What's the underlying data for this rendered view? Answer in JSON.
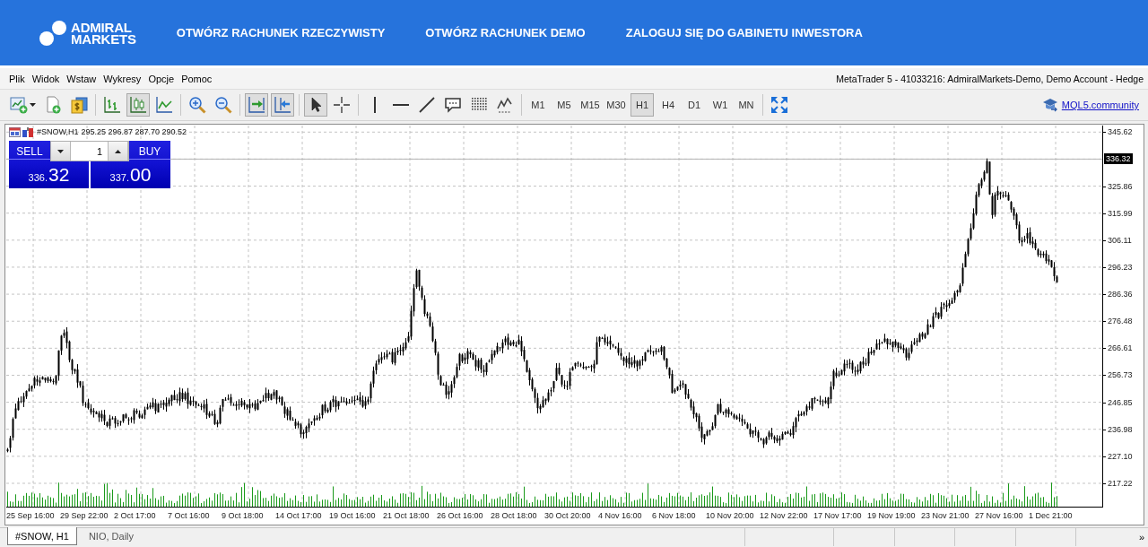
{
  "header": {
    "logo_lines": [
      "ADMIRAL",
      "MARKETS"
    ],
    "nav_links": [
      "OTWÓRZ RACHUNEK RZECZYWISTY",
      "OTWÓRZ RACHUNEK DEMO",
      "ZALOGUJ SIĘ DO GABINETU INWESTORA"
    ]
  },
  "menu_bar": {
    "items": [
      "Plik",
      "Widok",
      "Wstaw",
      "Wykresy",
      "Opcje",
      "Pomoc"
    ],
    "window_title": "MetaTrader 5 - 41033216: AdmiralMarkets-Demo, Demo Account - Hedge"
  },
  "toolbar": {
    "tool_groups": [
      {
        "tools": [
          {
            "kind": "new-chart",
            "pressed": false
          },
          {
            "kind": "new-document",
            "pressed": false
          },
          {
            "kind": "money",
            "pressed": false
          }
        ]
      },
      {
        "tools": [
          {
            "kind": "bar-chart",
            "pressed": false
          },
          {
            "kind": "candlesticks",
            "pressed": true
          },
          {
            "kind": "line-chart",
            "pressed": false
          }
        ]
      },
      {
        "tools": [
          {
            "kind": "zoom-in",
            "pressed": false
          },
          {
            "kind": "zoom-out",
            "pressed": false
          }
        ]
      },
      {
        "tools": [
          {
            "kind": "auto-scroll",
            "pressed": true
          },
          {
            "kind": "chart-shift",
            "pressed": true
          }
        ]
      },
      {
        "tools": [
          {
            "kind": "cursor",
            "pressed": true
          },
          {
            "kind": "crosshair",
            "pressed": false
          }
        ]
      },
      {
        "tools": [
          {
            "kind": "vertical-line",
            "pressed": false
          },
          {
            "kind": "horizontal-line",
            "pressed": false
          },
          {
            "kind": "trend-line",
            "pressed": false
          },
          {
            "kind": "text-label",
            "pressed": false
          },
          {
            "kind": "dot-grid",
            "pressed": false
          },
          {
            "kind": "zigzag",
            "pressed": false
          }
        ]
      }
    ],
    "timeframes": [
      {
        "label": "M1",
        "selected": false
      },
      {
        "label": "M5",
        "selected": false
      },
      {
        "label": "M15",
        "selected": false
      },
      {
        "label": "M30",
        "selected": false
      },
      {
        "label": "H1",
        "selected": true
      },
      {
        "label": "H4",
        "selected": false
      },
      {
        "label": "D1",
        "selected": false
      },
      {
        "label": "W1",
        "selected": false
      },
      {
        "label": "MN",
        "selected": false
      }
    ],
    "trailing_tools": [
      {
        "kind": "fullscreen",
        "pressed": false
      }
    ],
    "community_link": "MQL5.community"
  },
  "chart": {
    "symbol": "#SNOW,H1",
    "ohlc": "295.25 296.87 287.70 290.52",
    "trade_panel": {
      "sell_label": "SELL",
      "volume": "1",
      "buy_label": "BUY",
      "sell_price": {
        "prefix": "336.",
        "main": "32"
      },
      "buy_price": {
        "prefix": "337.",
        "main": "00"
      }
    },
    "price_ticks": [
      "345.62",
      "325.86",
      "315.99",
      "306.11",
      "296.23",
      "286.36",
      "276.48",
      "266.61",
      "256.73",
      "246.85",
      "236.98",
      "227.10",
      "217.22"
    ],
    "current_price": "336.32",
    "time_ticks": [
      "25 Sep 16:00",
      "29 Sep 22:00",
      "2 Oct 17:00",
      "7 Oct 16:00",
      "9 Oct 18:00",
      "14 Oct 17:00",
      "19 Oct 16:00",
      "21 Oct 18:00",
      "26 Oct 16:00",
      "28 Oct 18:00",
      "30 Oct 20:00",
      "4 Nov 16:00",
      "6 Nov 18:00",
      "10 Nov 20:00",
      "12 Nov 22:00",
      "17 Nov 17:00",
      "19 Nov 19:00",
      "23 Nov 21:00",
      "27 Nov 16:00",
      "1 Dec 21:00"
    ]
  },
  "tabs": [
    {
      "label": "#SNOW, H1",
      "selected": true
    },
    {
      "label": "NIO, Daily",
      "selected": false
    }
  ],
  "tabs_overflow": "»"
}
